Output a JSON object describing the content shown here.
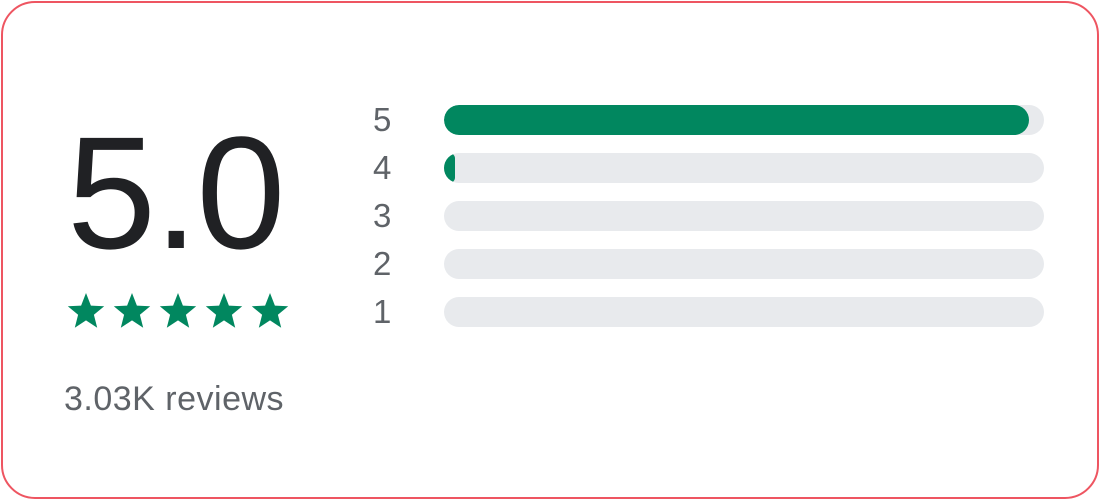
{
  "rating": {
    "score": "5.0",
    "stars": 5,
    "stars_max": 5,
    "reviews_label": "3.03K reviews"
  },
  "distribution": [
    {
      "label": "5",
      "fraction": 0.975
    },
    {
      "label": "4",
      "fraction": 0.018
    },
    {
      "label": "3",
      "fraction": 0.0
    },
    {
      "label": "2",
      "fraction": 0.0
    },
    {
      "label": "1",
      "fraction": 0.0
    }
  ],
  "colors": {
    "accent": "#01875f",
    "track": "#e8eaed",
    "border": "#ee5561",
    "score_text": "#202124",
    "secondary_text": "#5f6368"
  },
  "icons": {
    "star": "star-icon"
  }
}
